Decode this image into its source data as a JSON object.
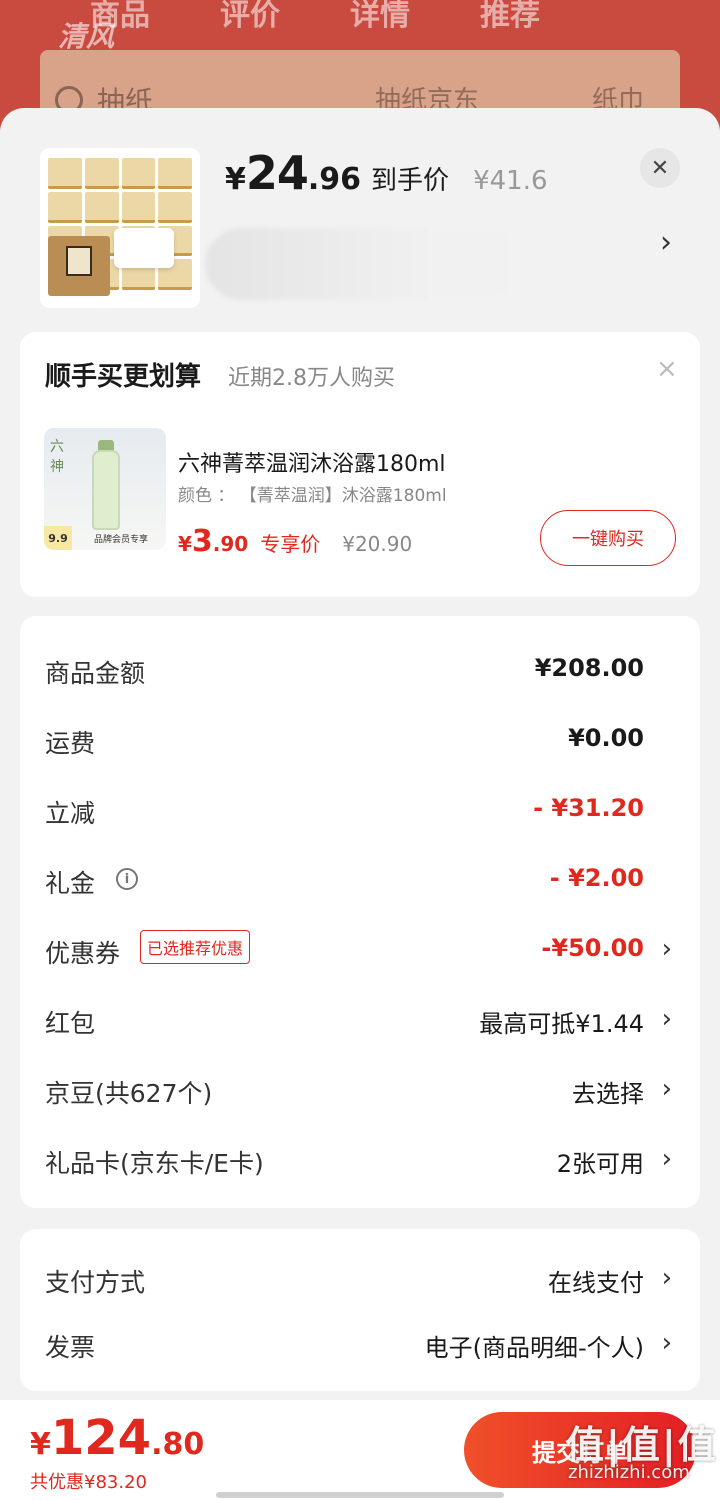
{
  "background": {
    "logo": "清风",
    "tabs": [
      "商品",
      "评价",
      "详情",
      "推荐"
    ],
    "search_text": "抽纸",
    "banner_text_1": "抽纸京东",
    "banner_text_2": "纸巾"
  },
  "product": {
    "currency": "¥",
    "price_int": "24",
    "price_dec": ".96",
    "price_tag": "到手价",
    "original_price": "¥41.6",
    "close_icon": "close-icon",
    "chevron": "›"
  },
  "upsell": {
    "title": "顺手买更划算",
    "subtitle": "近期2.8万人购买",
    "close": "×",
    "item_name": "六神菁萃温润沐浴露180ml",
    "item_spec": "颜色 ： 【菁萃温润】沐浴露180ml",
    "currency": "¥",
    "price_int": "3",
    "price_dec": ".90",
    "price_tag": "专享价",
    "original_price": "¥20.90",
    "buy_label": "一键购买",
    "image_badge": "9.9",
    "image_footer": "品牌会员专享"
  },
  "fees": {
    "rows": [
      {
        "label": "商品金额",
        "value": "¥208.00"
      },
      {
        "label": "运费",
        "value": "¥0.00"
      },
      {
        "label": "立减",
        "value": "- ¥31.20"
      },
      {
        "label": "礼金",
        "value": "- ¥2.00"
      },
      {
        "label": "优惠券",
        "badge": "已选推荐优惠",
        "value": "-¥50.00"
      },
      {
        "label": "红包",
        "value": "最高可抵¥1.44"
      },
      {
        "label": "京豆(共627个)",
        "value": "去选择"
      },
      {
        "label": "礼品卡(京东卡/E卡)",
        "value": "2张可用"
      }
    ],
    "info_glyph": "i"
  },
  "payment": {
    "rows": [
      {
        "label": "支付方式",
        "value": "在线支付"
      },
      {
        "label": "发票",
        "value": "电子(商品明细-个人)"
      }
    ]
  },
  "footer": {
    "currency": "¥",
    "total_int": "124",
    "total_dec": ".80",
    "savings": "共优惠¥83.20",
    "submit_label": "提交订单",
    "watermark_big": "值|值|值",
    "watermark_small": "zhizhizhi.com"
  },
  "colors": {
    "accent_red": "#e0281e",
    "background": "#f2f2f2"
  }
}
